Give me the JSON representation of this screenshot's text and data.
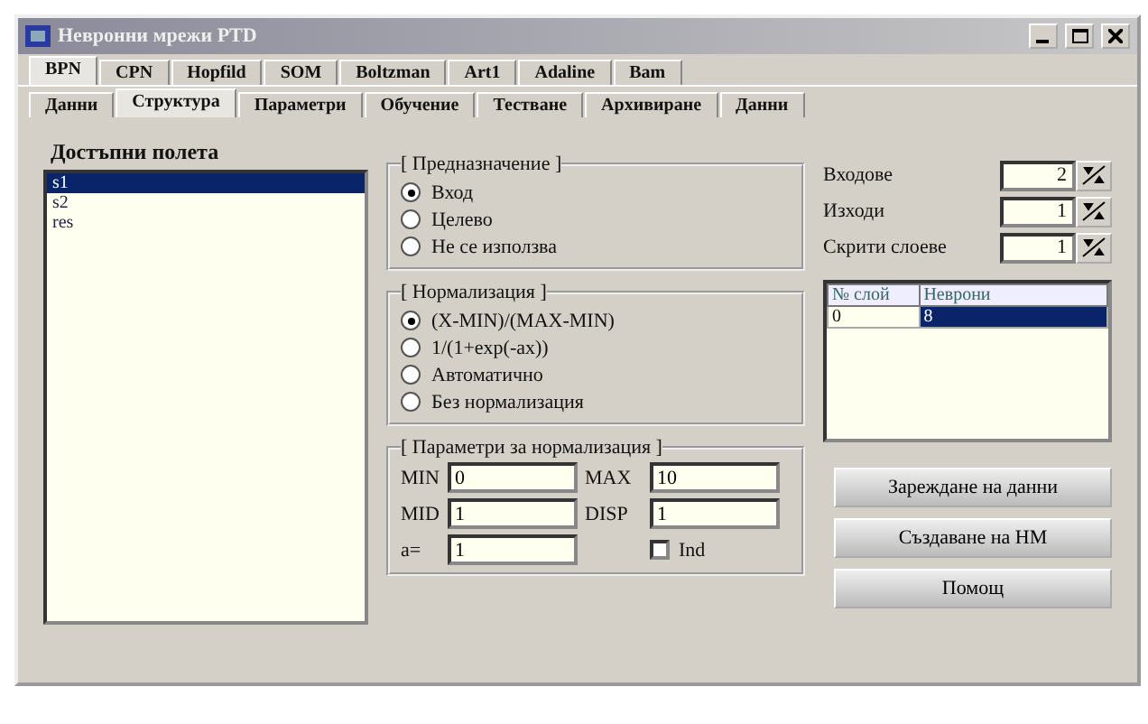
{
  "window": {
    "title": "Невронни мрежи PTD"
  },
  "tabs": [
    {
      "label": "BPN",
      "selected": true
    },
    {
      "label": "CPN",
      "selected": false
    },
    {
      "label": "Hopfild",
      "selected": false
    },
    {
      "label": "SOM",
      "selected": false
    },
    {
      "label": "Boltzman",
      "selected": false
    },
    {
      "label": "Art1",
      "selected": false
    },
    {
      "label": "Adaline",
      "selected": false
    },
    {
      "label": "Bam",
      "selected": false
    }
  ],
  "subtabs": [
    {
      "label": "Данни",
      "selected": false
    },
    {
      "label": "Структура",
      "selected": true
    },
    {
      "label": "Параметри",
      "selected": false
    },
    {
      "label": "Обучение",
      "selected": false
    },
    {
      "label": "Тестване",
      "selected": false
    },
    {
      "label": "Архивиране",
      "selected": false
    },
    {
      "label": "Данни",
      "selected": false
    }
  ],
  "fields": {
    "title": "Достъпни полета",
    "items": [
      {
        "label": "s1",
        "selected": true
      },
      {
        "label": "s2",
        "selected": false
      },
      {
        "label": "res",
        "selected": false
      }
    ]
  },
  "purpose": {
    "title": "[ Предназначение ]",
    "options": [
      {
        "label": "Вход",
        "selected": true
      },
      {
        "label": "Целево",
        "selected": false
      },
      {
        "label": "Не се използва",
        "selected": false
      }
    ]
  },
  "normalization": {
    "title": "[ Нормализация ]",
    "options": [
      {
        "label": "(X-MIN)/(MAX-MIN)",
        "selected": true
      },
      {
        "label": "1/(1+exp(-ax))",
        "selected": false
      },
      {
        "label": "Автоматично",
        "selected": false
      },
      {
        "label": "Без нормализация",
        "selected": false
      }
    ]
  },
  "params": {
    "title": "[ Параметри за нормализация ]",
    "min_label": "MIN",
    "min": "0",
    "max_label": "MAX",
    "max": "10",
    "mid_label": "MID",
    "mid": "1",
    "disp_label": "DISP",
    "disp": "1",
    "a_label": "a=",
    "a": "1",
    "ind": {
      "label": "Ind",
      "checked": false
    }
  },
  "spinners": [
    {
      "label": "Входове",
      "value": "2"
    },
    {
      "label": "Изходи",
      "value": "1"
    },
    {
      "label": "Скрити слоеве",
      "value": "1"
    }
  ],
  "layers": {
    "columns": [
      "№ слой",
      "Неврони"
    ],
    "rows": [
      {
        "cells": [
          "0",
          "8"
        ],
        "selected": true
      }
    ]
  },
  "buttons": [
    "Зареждане на данни",
    "Създаване на НМ",
    "Помощ"
  ]
}
